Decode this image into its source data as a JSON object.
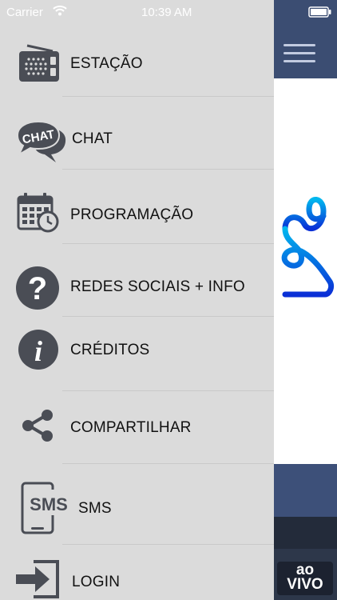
{
  "status_bar": {
    "carrier": "Carrier",
    "time": "10:39 AM"
  },
  "menu": {
    "items": [
      {
        "label": "ESTAÇÃO",
        "icon": "radio-icon"
      },
      {
        "label": "CHAT",
        "icon": "chat-bubble-icon",
        "icon_text": "CHAT"
      },
      {
        "label": "PROGRAMAÇÃO",
        "icon": "calendar-clock-icon"
      },
      {
        "label": "REDES SOCIAIS + INFO",
        "icon": "question-icon",
        "icon_text": "?"
      },
      {
        "label": "CRÉDITOS",
        "icon": "info-icon",
        "icon_text": "i"
      },
      {
        "label": "COMPARTILHAR",
        "icon": "share-icon"
      },
      {
        "label": "SMS",
        "icon": "sms-phone-icon",
        "icon_text": "SMS"
      },
      {
        "label": "LOGIN",
        "icon": "login-icon"
      }
    ]
  },
  "right_panel": {
    "live_badge": {
      "line1": "ao",
      "line2": "VIVO"
    }
  },
  "colors": {
    "drawer_bg": "#dbdbdb",
    "icon": "#4a4d55",
    "navbar": "#3b4d72",
    "logo_gradient": [
      "#00b6ee",
      "#0a2fd6"
    ]
  }
}
